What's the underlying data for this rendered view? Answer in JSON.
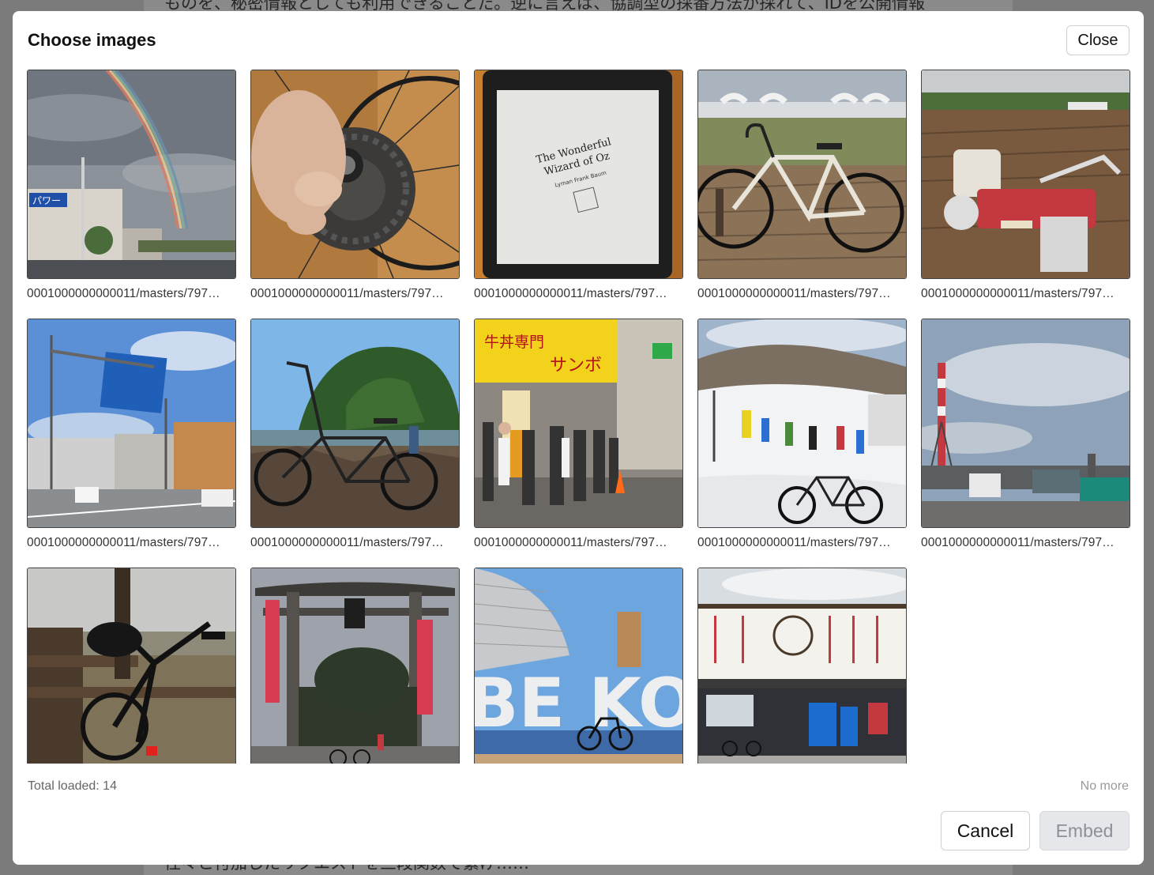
{
  "background": {
    "top_text": "ものを、秘密情報としても利用できることだ。逆に言えば、協調型の採番方法が採れて、IDを公開情報",
    "bottom_text": "性々と付加したリクエストを三段関数で繋げ……"
  },
  "modal": {
    "title": "Choose images",
    "close_label": "Close",
    "total_loaded": "Total loaded: 14",
    "no_more": "No more",
    "cancel_label": "Cancel",
    "embed_label": "Embed"
  },
  "images": [
    {
      "caption": "0001000000000011/masters/797…",
      "icon": "rainbow-photo"
    },
    {
      "caption": "0001000000000011/masters/797…",
      "icon": "sprocket-photo"
    },
    {
      "caption": "0001000000000011/masters/797…",
      "icon": "ebook-photo",
      "text1": "The Wonderful",
      "text2": "Wizard of Oz",
      "text3": "Lyman Frank Baum"
    },
    {
      "caption": "0001000000000011/masters/797…",
      "icon": "road-bike-photo"
    },
    {
      "caption": "0001000000000011/masters/797…",
      "icon": "tiller-photo"
    },
    {
      "caption": "0001000000000011/masters/797…",
      "icon": "street-sign-photo"
    },
    {
      "caption": "0001000000000011/masters/797…",
      "icon": "folding-bike-rocks-photo"
    },
    {
      "caption": "0001000000000011/masters/797…",
      "icon": "restaurant-queue-photo",
      "text1": "牛丼専門",
      "text2": "サンボ"
    },
    {
      "caption": "0001000000000011/masters/797…",
      "icon": "ski-slope-photo"
    },
    {
      "caption": "0001000000000011/masters/797…",
      "icon": "factory-photo"
    },
    {
      "caption": "",
      "icon": "bike-bench-photo"
    },
    {
      "caption": "",
      "icon": "torii-gate-photo"
    },
    {
      "caption": "",
      "icon": "kobe-sign-photo",
      "text1": "BE KOBE"
    },
    {
      "caption": "",
      "icon": "udon-shop-photo"
    }
  ]
}
